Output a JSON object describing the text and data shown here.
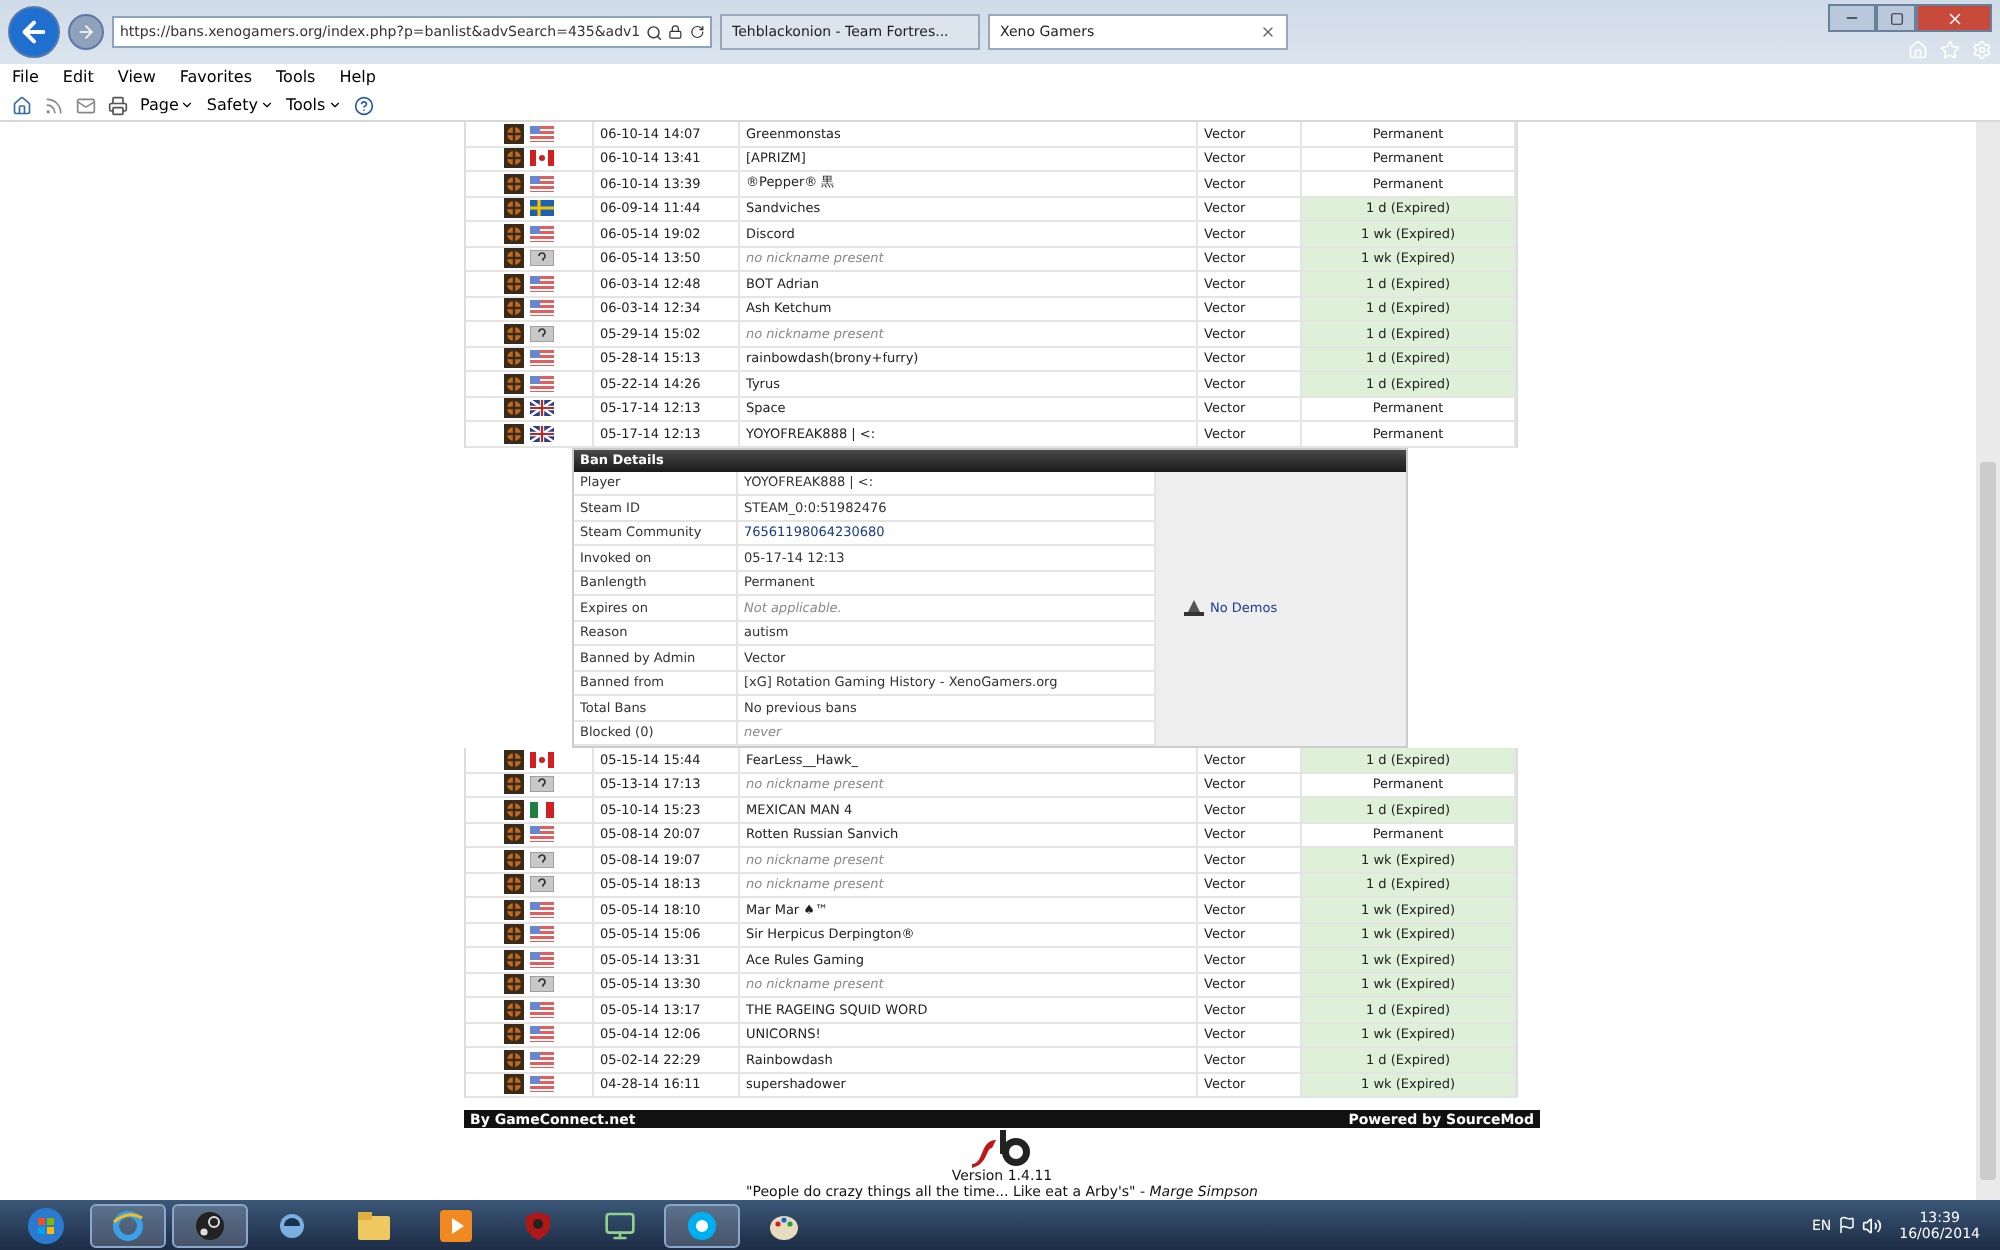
{
  "browser": {
    "address": "https://bans.xenogamers.org/index.php?p=banlist&advSearch=435&adv1",
    "tabs": [
      {
        "label": "Tehblackonion - Team Fortres...",
        "selected": false
      },
      {
        "label": "Xeno Gamers",
        "selected": true
      }
    ],
    "menu": [
      "File",
      "Edit",
      "View",
      "Favorites",
      "Tools",
      "Help"
    ],
    "commands": [
      "Page",
      "Safety",
      "Tools"
    ]
  },
  "bans": {
    "rows_before": [
      {
        "kind": "us",
        "date": "06-10-14 14:07",
        "name": "Greenmonstas",
        "anonymous": false,
        "admin": "Vector",
        "length": "Permanent",
        "expired": false
      },
      {
        "kind": "ca",
        "date": "06-10-14 13:41",
        "name": "[APRIZM]",
        "anonymous": false,
        "admin": "Vector",
        "length": "Permanent",
        "expired": false
      },
      {
        "kind": "us",
        "date": "06-10-14 13:39",
        "name": "®Pepper® 黒",
        "anonymous": false,
        "admin": "Vector",
        "length": "Permanent",
        "expired": false
      },
      {
        "kind": "se",
        "date": "06-09-14 11:44",
        "name": "Sandviches",
        "anonymous": false,
        "admin": "Vector",
        "length": "1 d (Expired)",
        "expired": true
      },
      {
        "kind": "us",
        "date": "06-05-14 19:02",
        "name": "Discord",
        "anonymous": false,
        "admin": "Vector",
        "length": "1 wk (Expired)",
        "expired": true
      },
      {
        "kind": "unknown",
        "date": "06-05-14 13:50",
        "name": "no nickname present",
        "anonymous": true,
        "admin": "Vector",
        "length": "1 wk (Expired)",
        "expired": true
      },
      {
        "kind": "us",
        "date": "06-03-14 12:48",
        "name": "BOT Adrian",
        "anonymous": false,
        "admin": "Vector",
        "length": "1 d (Expired)",
        "expired": true
      },
      {
        "kind": "us",
        "date": "06-03-14 12:34",
        "name": "Ash Ketchum",
        "anonymous": false,
        "admin": "Vector",
        "length": "1 d (Expired)",
        "expired": true
      },
      {
        "kind": "unknown",
        "date": "05-29-14 15:02",
        "name": "no nickname present",
        "anonymous": true,
        "admin": "Vector",
        "length": "1 d (Expired)",
        "expired": true
      },
      {
        "kind": "us",
        "date": "05-28-14 15:13",
        "name": "rainbowdash(brony+furry)",
        "anonymous": false,
        "admin": "Vector",
        "length": "1 d (Expired)",
        "expired": true
      },
      {
        "kind": "us",
        "date": "05-22-14 14:26",
        "name": "Tyrus",
        "anonymous": false,
        "admin": "Vector",
        "length": "1 d (Expired)",
        "expired": true
      },
      {
        "kind": "gb",
        "date": "05-17-14 12:13",
        "name": "Space",
        "anonymous": false,
        "admin": "Vector",
        "length": "Permanent",
        "expired": false
      },
      {
        "kind": "gb",
        "date": "05-17-14 12:13",
        "name": "YOYOFREAK888 | <:",
        "anonymous": false,
        "admin": "Vector",
        "length": "Permanent",
        "expired": false
      }
    ],
    "details": {
      "title": "Ban Details",
      "demos": "No Demos",
      "fields": [
        {
          "label": "Player",
          "value": "YOYOFREAK888 | <:",
          "kind": "plain"
        },
        {
          "label": "Steam ID",
          "value": "STEAM_0:0:51982476",
          "kind": "plain"
        },
        {
          "label": "Steam Community",
          "value": "76561198064230680",
          "kind": "link"
        },
        {
          "label": "Invoked on",
          "value": "05-17-14 12:13",
          "kind": "plain"
        },
        {
          "label": "Banlength",
          "value": "Permanent",
          "kind": "plain"
        },
        {
          "label": "Expires on",
          "value": "Not applicable.",
          "kind": "muted"
        },
        {
          "label": "Reason",
          "value": "autism",
          "kind": "plain"
        },
        {
          "label": "Banned by Admin",
          "value": "Vector",
          "kind": "plain"
        },
        {
          "label": "Banned from",
          "value": "[xG] Rotation Gaming History - XenoGamers.org",
          "kind": "plain"
        },
        {
          "label": "Total Bans",
          "value": "No previous bans",
          "kind": "plain"
        },
        {
          "label": "Blocked (0)",
          "value": "never",
          "kind": "muted"
        }
      ]
    },
    "rows_after": [
      {
        "kind": "ca",
        "date": "05-15-14 15:44",
        "name": "FearLess__Hawk_",
        "anonymous": false,
        "admin": "Vector",
        "length": "1 d (Expired)",
        "expired": true
      },
      {
        "kind": "unknown",
        "date": "05-13-14 17:13",
        "name": "no nickname present",
        "anonymous": true,
        "admin": "Vector",
        "length": "Permanent",
        "expired": false
      },
      {
        "kind": "mx",
        "date": "05-10-14 15:23",
        "name": "MEXICAN MAN 4",
        "anonymous": false,
        "admin": "Vector",
        "length": "1 d (Expired)",
        "expired": true
      },
      {
        "kind": "us",
        "date": "05-08-14 20:07",
        "name": "Rotten Russian Sanvich",
        "anonymous": false,
        "admin": "Vector",
        "length": "Permanent",
        "expired": false
      },
      {
        "kind": "unknown",
        "date": "05-08-14 19:07",
        "name": "no nickname present",
        "anonymous": true,
        "admin": "Vector",
        "length": "1 wk (Expired)",
        "expired": true
      },
      {
        "kind": "unknown",
        "date": "05-05-14 18:13",
        "name": "no nickname present",
        "anonymous": true,
        "admin": "Vector",
        "length": "1 d (Expired)",
        "expired": true
      },
      {
        "kind": "us",
        "date": "05-05-14 18:10",
        "name": "Mar Mar ♠™",
        "anonymous": false,
        "admin": "Vector",
        "length": "1 wk (Expired)",
        "expired": true
      },
      {
        "kind": "us",
        "date": "05-05-14 15:06",
        "name": "Sir Herpicus Derpington®",
        "anonymous": false,
        "admin": "Vector",
        "length": "1 wk (Expired)",
        "expired": true
      },
      {
        "kind": "us",
        "date": "05-05-14 13:31",
        "name": "Ace Rules Gaming",
        "anonymous": false,
        "admin": "Vector",
        "length": "1 wk (Expired)",
        "expired": true
      },
      {
        "kind": "unknown",
        "date": "05-05-14 13:30",
        "name": "no nickname present",
        "anonymous": true,
        "admin": "Vector",
        "length": "1 wk (Expired)",
        "expired": true
      },
      {
        "kind": "us",
        "date": "05-05-14 13:17",
        "name": "THE RAGEING SQUID WORD",
        "anonymous": false,
        "admin": "Vector",
        "length": "1 d (Expired)",
        "expired": true
      },
      {
        "kind": "us",
        "date": "05-04-14 12:06",
        "name": "UNICORNS!",
        "anonymous": false,
        "admin": "Vector",
        "length": "1 wk (Expired)",
        "expired": true
      },
      {
        "kind": "us",
        "date": "05-02-14 22:29",
        "name": "Rainbowdash",
        "anonymous": false,
        "admin": "Vector",
        "length": "1 d (Expired)",
        "expired": true
      },
      {
        "kind": "us",
        "date": "04-28-14 16:11",
        "name": "supershadower",
        "anonymous": false,
        "admin": "Vector",
        "length": "1 wk (Expired)",
        "expired": true
      }
    ]
  },
  "footer": {
    "left": "By GameConnect.net",
    "right": "Powered by SourceMod",
    "version": "Version 1.4.11",
    "quote": "\"People do crazy things all the time... Like eat a Arby's\" - *Marge Simpson*"
  },
  "taskbar": {
    "language": "EN",
    "time": "13:39",
    "date": "16/06/2014"
  }
}
